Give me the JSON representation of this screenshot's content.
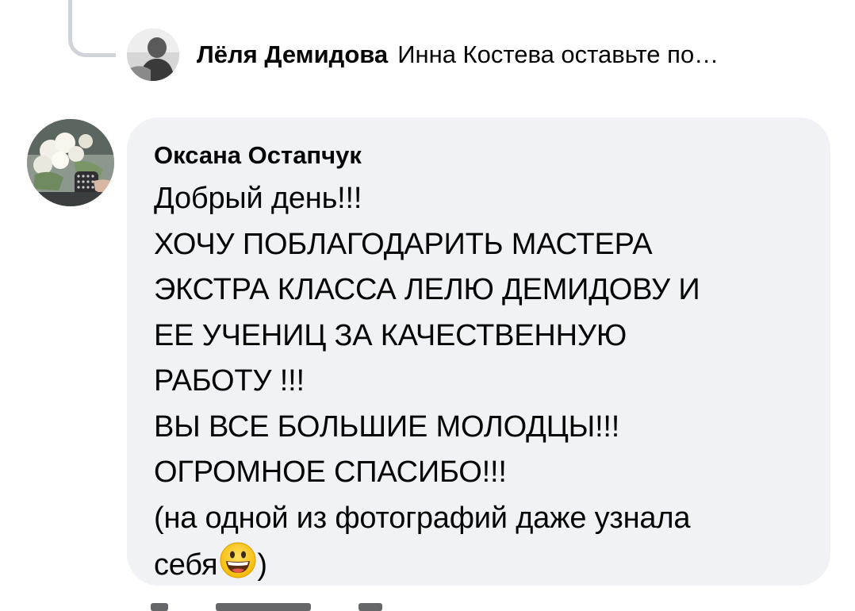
{
  "reply": {
    "author": "Лёля Демидова",
    "text": "Инна Костева  оставьте по…"
  },
  "comment": {
    "author": "Оксана Остапчук",
    "lines": [
      "Добрый день!!!",
      "ХОЧУ ПОБЛАГОДАРИТЬ МАСТЕРА",
      "ЭКСТРА КЛАССА ЛЕЛЮ ДЕМИДОВУ И",
      "ЕЕ УЧЕНИЦ ЗА КАЧЕСТВЕННУЮ",
      "РАБОТУ !!!",
      "ВЫ ВСЕ БОЛЬШИЕ МОЛОДЦЫ!!!",
      "ОГРОМНОЕ СПАСИБО!!!",
      "(на одной из фотографий даже узнала"
    ],
    "last_line_before_emoji": "себя",
    "last_line_after_emoji": ")",
    "emoji": "grinning-face-emoji"
  },
  "colors": {
    "bubble_background": "#f0f2f5",
    "text": "#050505",
    "thread_line": "#d0d3d9"
  }
}
